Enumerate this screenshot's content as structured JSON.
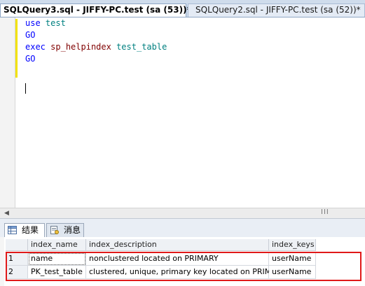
{
  "tabs": [
    {
      "label": "SQLQuery3.sql - JIFFY-PC.test (sa (53))*"
    },
    {
      "label": "SQLQuery2.sql - JIFFY-PC.test (sa (52))*"
    }
  ],
  "editor": {
    "lines": [
      {
        "k": "use",
        "rest": "test"
      },
      {
        "k": "GO"
      },
      {
        "k": "exec",
        "proc": "sp_helpindex",
        "rest": "test_table"
      },
      {
        "k": "GO"
      }
    ]
  },
  "scrollbar": {
    "left_arrow": "◀",
    "grip": "III"
  },
  "results_tabs": [
    {
      "label": "结果",
      "icon": "grid-icon"
    },
    {
      "label": "消息",
      "icon": "message-icon"
    }
  ],
  "grid": {
    "columns": [
      "index_name",
      "index_description",
      "index_keys"
    ],
    "rows": [
      {
        "num": "1",
        "cells": [
          "name",
          "nonclustered located on PRIMARY",
          "userName"
        ]
      },
      {
        "num": "2",
        "cells": [
          "PK_test_table",
          "clustered, unique, primary key located on PRIMARY",
          "userName"
        ]
      }
    ]
  },
  "colors": {
    "highlight": "#e01919",
    "keyword": "#0000ff",
    "procedure": "#800000",
    "identifier": "#008080"
  }
}
